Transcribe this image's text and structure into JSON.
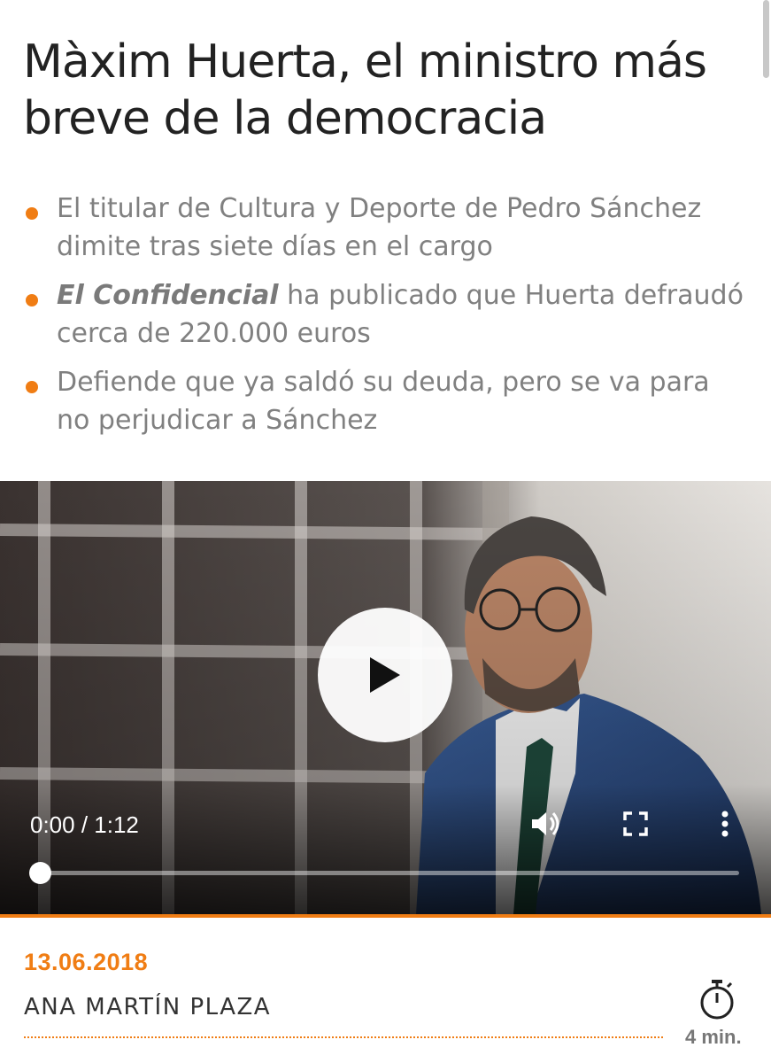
{
  "article": {
    "headline": "Màxim Huerta, el ministro más breve de la democracia",
    "bullets": [
      {
        "text": "El titular de Cultura y Deporte de Pedro Sánchez dimite tras siete días en el cargo"
      },
      {
        "emphasis": "El Confidencial",
        "text": " ha publicado que Huerta defraudó cerca de 220.000 euros"
      },
      {
        "text": "Defiende que ya saldó su deuda, pero se va para no perjudicar a Sánchez"
      }
    ],
    "date": "13.06.2018",
    "author": "ANA MARTÍN PLAZA",
    "read_time": "4 min."
  },
  "video": {
    "time_display": "0:00 / 1:12",
    "progress_fraction": 0,
    "icons": {
      "play": "play-icon",
      "volume": "volume-icon",
      "fullscreen": "fullscreen-icon",
      "more": "more-options-icon"
    }
  },
  "colors": {
    "accent": "#f07d14",
    "headline": "#222222",
    "bullet_text": "#808080"
  }
}
